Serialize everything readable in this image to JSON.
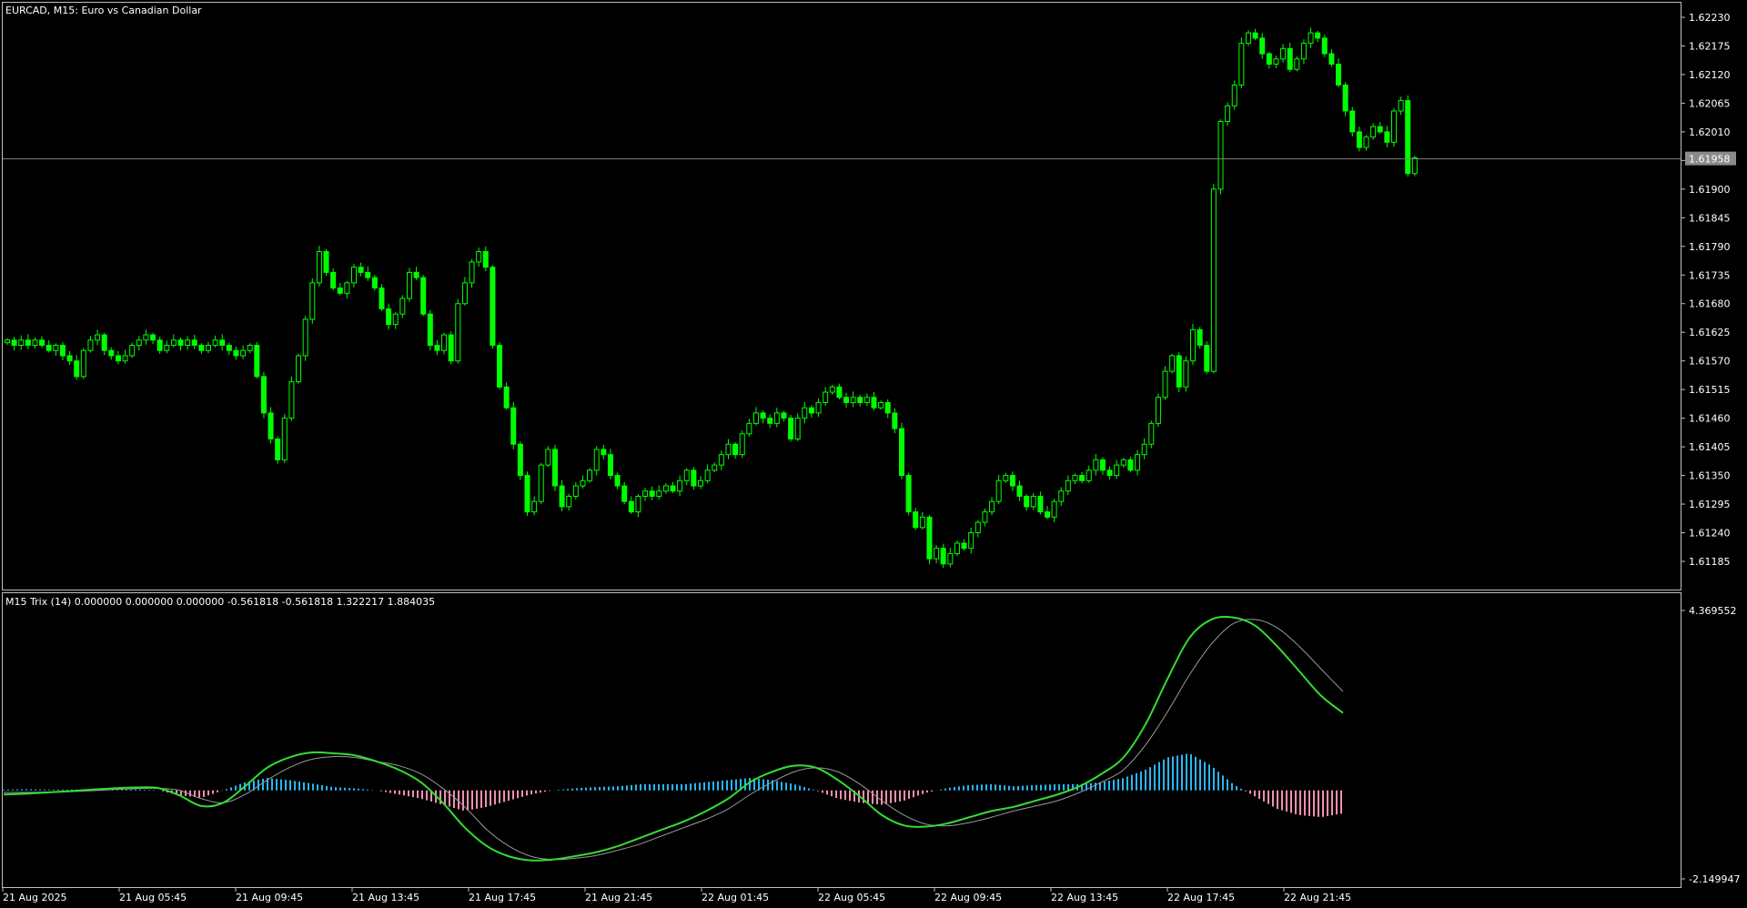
{
  "chart_data": [
    {
      "type": "candlestick",
      "title": "EURCAD, M15:  Euro vs Canadian Dollar",
      "ylim": [
        1.6113,
        1.6228
      ],
      "y_ticks": [
        "1.62230",
        "1.62175",
        "1.62120",
        "1.62065",
        "1.62010",
        "1.61955",
        "1.61900",
        "1.61845",
        "1.61790",
        "1.61735",
        "1.61680",
        "1.61625",
        "1.61570",
        "1.61515",
        "1.61460",
        "1.61405",
        "1.61350",
        "1.61295",
        "1.61240",
        "1.61185"
      ],
      "current_price": "1.61958",
      "candle_color": "#00ff00",
      "closes": [
        1.6161,
        1.616,
        1.6161,
        1.616,
        1.6161,
        1.616,
        1.6159,
        1.616,
        1.6158,
        1.6157,
        1.6154,
        1.6159,
        1.6161,
        1.6162,
        1.6159,
        1.6158,
        1.6157,
        1.6158,
        1.616,
        1.6161,
        1.6162,
        1.6161,
        1.6159,
        1.616,
        1.6161,
        1.616,
        1.6161,
        1.616,
        1.6159,
        1.616,
        1.6161,
        1.616,
        1.6159,
        1.6158,
        1.6159,
        1.616,
        1.6154,
        1.6147,
        1.6142,
        1.6138,
        1.6146,
        1.6153,
        1.6158,
        1.6165,
        1.6172,
        1.6178,
        1.6174,
        1.6171,
        1.617,
        1.6172,
        1.6175,
        1.6174,
        1.6173,
        1.6171,
        1.6167,
        1.6164,
        1.6166,
        1.6169,
        1.6174,
        1.6173,
        1.6166,
        1.616,
        1.6159,
        1.6162,
        1.6157,
        1.6168,
        1.6172,
        1.6176,
        1.6178,
        1.6175,
        1.616,
        1.6152,
        1.6148,
        1.6141,
        1.6135,
        1.6128,
        1.613,
        1.6137,
        1.614,
        1.6133,
        1.6129,
        1.6131,
        1.6133,
        1.6134,
        1.6136,
        1.614,
        1.6139,
        1.6135,
        1.6133,
        1.613,
        1.6128,
        1.6131,
        1.6132,
        1.6131,
        1.6132,
        1.6133,
        1.6132,
        1.6134,
        1.6136,
        1.6133,
        1.6134,
        1.6136,
        1.6137,
        1.6139,
        1.6141,
        1.6139,
        1.6143,
        1.6145,
        1.6147,
        1.6146,
        1.6145,
        1.6147,
        1.6146,
        1.6142,
        1.6146,
        1.6148,
        1.6147,
        1.6149,
        1.6151,
        1.6152,
        1.615,
        1.6149,
        1.615,
        1.6149,
        1.615,
        1.6148,
        1.6149,
        1.6147,
        1.6144,
        1.6135,
        1.6128,
        1.6125,
        1.6127,
        1.6119,
        1.6121,
        1.6118,
        1.612,
        1.6122,
        1.6121,
        1.6124,
        1.6126,
        1.6128,
        1.613,
        1.6134,
        1.6135,
        1.6133,
        1.6131,
        1.6129,
        1.6131,
        1.6128,
        1.6127,
        1.613,
        1.6132,
        1.6134,
        1.6135,
        1.6134,
        1.6136,
        1.6138,
        1.6136,
        1.6135,
        1.6137,
        1.6138,
        1.6136,
        1.6139,
        1.6141,
        1.6145,
        1.615,
        1.6155,
        1.6158,
        1.6152,
        1.6157,
        1.6163,
        1.616,
        1.6155,
        1.619,
        1.6203,
        1.6206,
        1.621,
        1.6218,
        1.622,
        1.6219,
        1.6216,
        1.6214,
        1.6215,
        1.6217,
        1.6213,
        1.6215,
        1.6218,
        1.622,
        1.6219,
        1.6216,
        1.6214,
        1.621,
        1.6205,
        1.6201,
        1.6198,
        1.62,
        1.6202,
        1.6201,
        1.6199,
        1.6205,
        1.6207,
        1.6193,
        1.6196
      ]
    },
    {
      "type": "line",
      "title": "M15 Trix (14) 0.000000 0.000000 0.000000 -0.561818 -0.561818 1.322217 1.884035",
      "ylim": [
        -2.149947,
        4.369552
      ],
      "y_ticks": [
        "4.369552",
        "-2.149947"
      ],
      "series": [
        {
          "color": "#33dd33",
          "values": [
            -0.1,
            -0.08,
            -0.05,
            -0.02,
            0.02,
            0.05,
            0.07,
            0.06,
            -0.12,
            -0.38,
            -0.3,
            0.1,
            0.55,
            0.8,
            0.92,
            0.9,
            0.85,
            0.7,
            0.5,
            0.2,
            -0.3,
            -0.9,
            -1.35,
            -1.6,
            -1.7,
            -1.68,
            -1.6,
            -1.5,
            -1.35,
            -1.15,
            -0.95,
            -0.75,
            -0.5,
            -0.2,
            0.2,
            0.45,
            0.6,
            0.55,
            0.25,
            -0.15,
            -0.6,
            -0.85,
            -0.88,
            -0.8,
            -0.65,
            -0.5,
            -0.4,
            -0.25,
            -0.1,
            0.1,
            0.4,
            0.8,
            1.6,
            2.7,
            3.7,
            4.15,
            4.2,
            4.0,
            3.5,
            2.9,
            2.3,
            1.88
          ]
        },
        {
          "color": "#999999",
          "values": [
            -0.05,
            -0.05,
            -0.04,
            -0.03,
            -0.01,
            0.02,
            0.04,
            0.05,
            0.0,
            -0.2,
            -0.3,
            -0.1,
            0.25,
            0.55,
            0.75,
            0.82,
            0.8,
            0.7,
            0.6,
            0.4,
            0.05,
            -0.4,
            -0.95,
            -1.35,
            -1.6,
            -1.68,
            -1.65,
            -1.58,
            -1.45,
            -1.3,
            -1.1,
            -0.9,
            -0.7,
            -0.45,
            -0.1,
            0.2,
            0.45,
            0.55,
            0.45,
            0.15,
            -0.25,
            -0.6,
            -0.82,
            -0.86,
            -0.78,
            -0.65,
            -0.5,
            -0.38,
            -0.25,
            -0.05,
            0.2,
            0.5,
            1.1,
            1.9,
            2.8,
            3.55,
            4.05,
            4.15,
            3.95,
            3.5,
            2.95,
            2.4
          ]
        },
        {
          "type": "histogram",
          "values": [
            0.02,
            0.03,
            0.02,
            0.02,
            0.02,
            0.02,
            0.02,
            0.01,
            -0.12,
            -0.18,
            0.0,
            0.2,
            0.3,
            0.25,
            0.17,
            0.08,
            0.05,
            0.0,
            -0.1,
            -0.2,
            -0.35,
            -0.5,
            -0.4,
            -0.25,
            -0.1,
            0.0,
            0.05,
            0.08,
            0.1,
            0.15,
            0.15,
            0.15,
            0.2,
            0.25,
            0.3,
            0.25,
            0.15,
            0.0,
            -0.2,
            -0.3,
            -0.35,
            -0.25,
            -0.06,
            0.06,
            0.13,
            0.15,
            0.1,
            0.13,
            0.15,
            0.15,
            0.2,
            0.3,
            0.5,
            0.8,
            0.9,
            0.6,
            0.15,
            -0.15,
            -0.45,
            -0.6,
            -0.65,
            -0.56
          ]
        }
      ]
    }
  ],
  "x_labels": [
    "21 Aug 2025",
    "21 Aug 05:45",
    "21 Aug 09:45",
    "21 Aug 13:45",
    "21 Aug 17:45",
    "21 Aug 21:45",
    "22 Aug 01:45",
    "22 Aug 05:45",
    "22 Aug 09:45",
    "22 Aug 13:45",
    "22 Aug 17:45",
    "22 Aug 21:45"
  ],
  "colors": {
    "background": "#000000",
    "grid_frame": "#c0c0c0",
    "bull": "#00ff00",
    "hist_pos": "#29b6f6",
    "hist_neg": "#f48fb1",
    "price_line": "#808080",
    "price_tag_bg": "#8a8a8a"
  }
}
